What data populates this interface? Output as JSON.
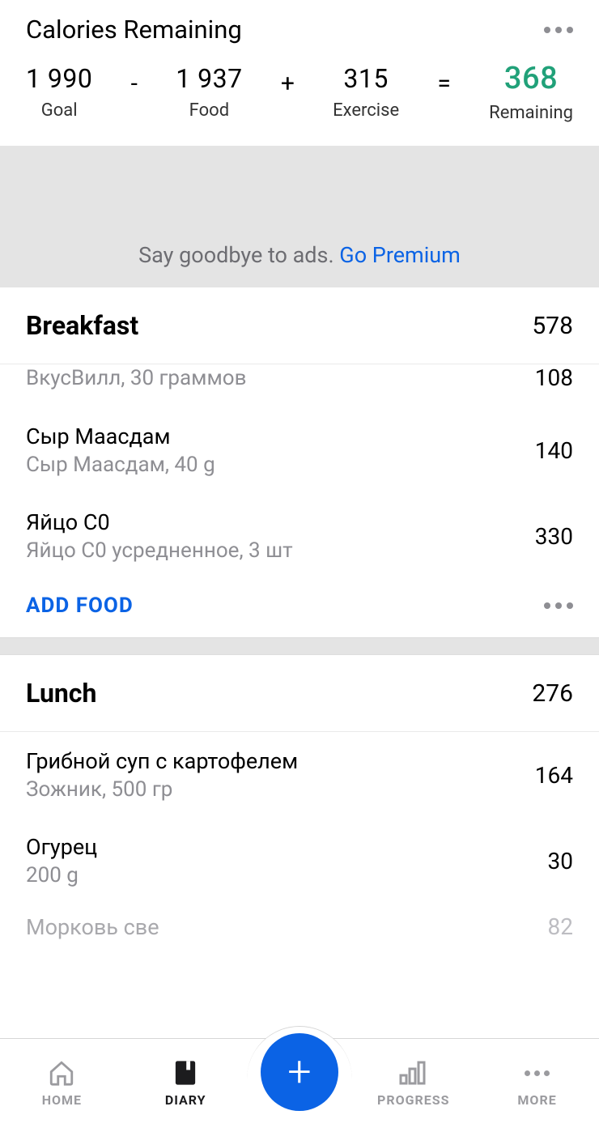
{
  "summary": {
    "title": "Calories Remaining",
    "goal_value": "1 990",
    "goal_label": "Goal",
    "food_value": "1 937",
    "food_label": "Food",
    "exercise_value": "315",
    "exercise_label": "Exercise",
    "remaining_value": "368",
    "remaining_label": "Remaining",
    "op_minus": "-",
    "op_plus": "+",
    "op_equals": "="
  },
  "ad": {
    "text": "Say goodbye to ads. ",
    "link": "Go Premium"
  },
  "meals": {
    "breakfast": {
      "name": "Breakfast",
      "total": "578",
      "items": [
        {
          "name": "",
          "sub": "ВкусВилл, 30 граммов",
          "cal": "108"
        },
        {
          "name": "Сыр Маасдам",
          "sub": "Сыр Маасдам, 40 g",
          "cal": "140"
        },
        {
          "name": "Яйцо С0",
          "sub": "Яйцо С0 усредненное, 3 шт",
          "cal": "330"
        }
      ],
      "add_label": "ADD FOOD"
    },
    "lunch": {
      "name": "Lunch",
      "total": "276",
      "items": [
        {
          "name": "Грибной суп с картофелем",
          "sub": "Зожник, 500 гр",
          "cal": "164"
        },
        {
          "name": "Огурец",
          "sub": "200 g",
          "cal": "30"
        }
      ],
      "partial": {
        "name_fragment": "Морковь све",
        "cal": "82"
      }
    }
  },
  "nav": {
    "home": "HOME",
    "diary": "DIARY",
    "progress": "PROGRESS",
    "more": "MORE"
  }
}
